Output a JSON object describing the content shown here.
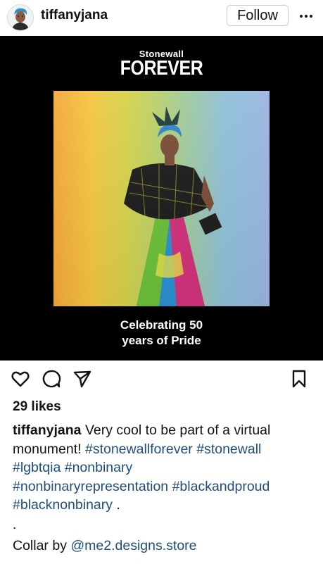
{
  "header": {
    "username": "tiffanyjana",
    "follow_label": "Follow",
    "more_icon": "more-horizontal-icon"
  },
  "post": {
    "brand_small": "Stonewall",
    "brand_big": "FOREVER",
    "caption_line1": "Celebrating 50",
    "caption_line2": "years of Pride",
    "photo_colors": [
      "#f5a63c",
      "#f4c63f",
      "#b9cf6a",
      "#8ebfd9",
      "#9bb4e0"
    ]
  },
  "actions": {
    "like_icon": "heart-icon",
    "comment_icon": "comment-icon",
    "share_icon": "send-icon",
    "save_icon": "bookmark-icon"
  },
  "likes": "29 likes",
  "caption": {
    "username": "tiffanyjana",
    "text": " Very cool to be part of a virtual monument! ",
    "tags1": [
      "#stonewallforever",
      "#stonewall"
    ],
    "tags2": [
      "#lgbtqia",
      "#nonbinary"
    ],
    "tags3": [
      "#nonbinaryrepresentation",
      "#blackandproud"
    ],
    "tags4": [
      "#blacknonbinary"
    ],
    "tail": " ."
  },
  "dot": ".",
  "credit": {
    "prefix": "Collar by ",
    "handle": "@me2.designs.store"
  }
}
